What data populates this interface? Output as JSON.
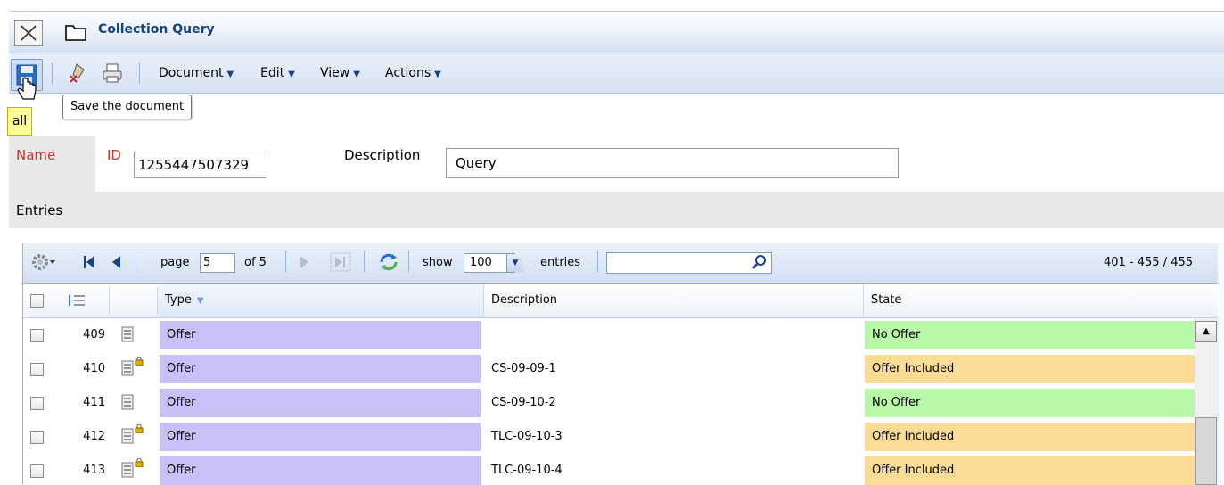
{
  "window": {
    "title": "Collection Query"
  },
  "toolbar": {
    "menus": [
      "Document",
      "Edit",
      "View",
      "Actions"
    ],
    "caret": "▼",
    "tooltip": "Save the document"
  },
  "tab": {
    "label": "all"
  },
  "form": {
    "name_label": "Name",
    "id_label": "ID",
    "id_value": "1255447507329",
    "description_label": "Description",
    "description_value": "Query",
    "entries_label": "Entries"
  },
  "pager": {
    "page_label": "page",
    "page_value": "5",
    "of_label": "of 5",
    "show_label": "show",
    "show_value": "100",
    "entries_label": "entries",
    "range": "401 - 455 / 455"
  },
  "columns": {
    "type": "Type",
    "description": "Description",
    "state": "State"
  },
  "rows": [
    {
      "num": "409",
      "type": "Offer",
      "description": "",
      "state": "No Offer",
      "locked": false
    },
    {
      "num": "410",
      "type": "Offer",
      "description": "CS-09-09-1",
      "state": "Offer Included",
      "locked": true
    },
    {
      "num": "411",
      "type": "Offer",
      "description": "CS-09-10-2",
      "state": "No Offer",
      "locked": false
    },
    {
      "num": "412",
      "type": "Offer",
      "description": "TLC-09-10-3",
      "state": "Offer Included",
      "locked": true
    },
    {
      "num": "413",
      "type": "Offer",
      "description": "TLC-09-10-4",
      "state": "Offer Included",
      "locked": true
    }
  ],
  "colors": {
    "type_bg": "#c9c0f8",
    "no_offer": "#b8f8a8",
    "offer_included": "#fcdc94",
    "title": "#15428b"
  }
}
